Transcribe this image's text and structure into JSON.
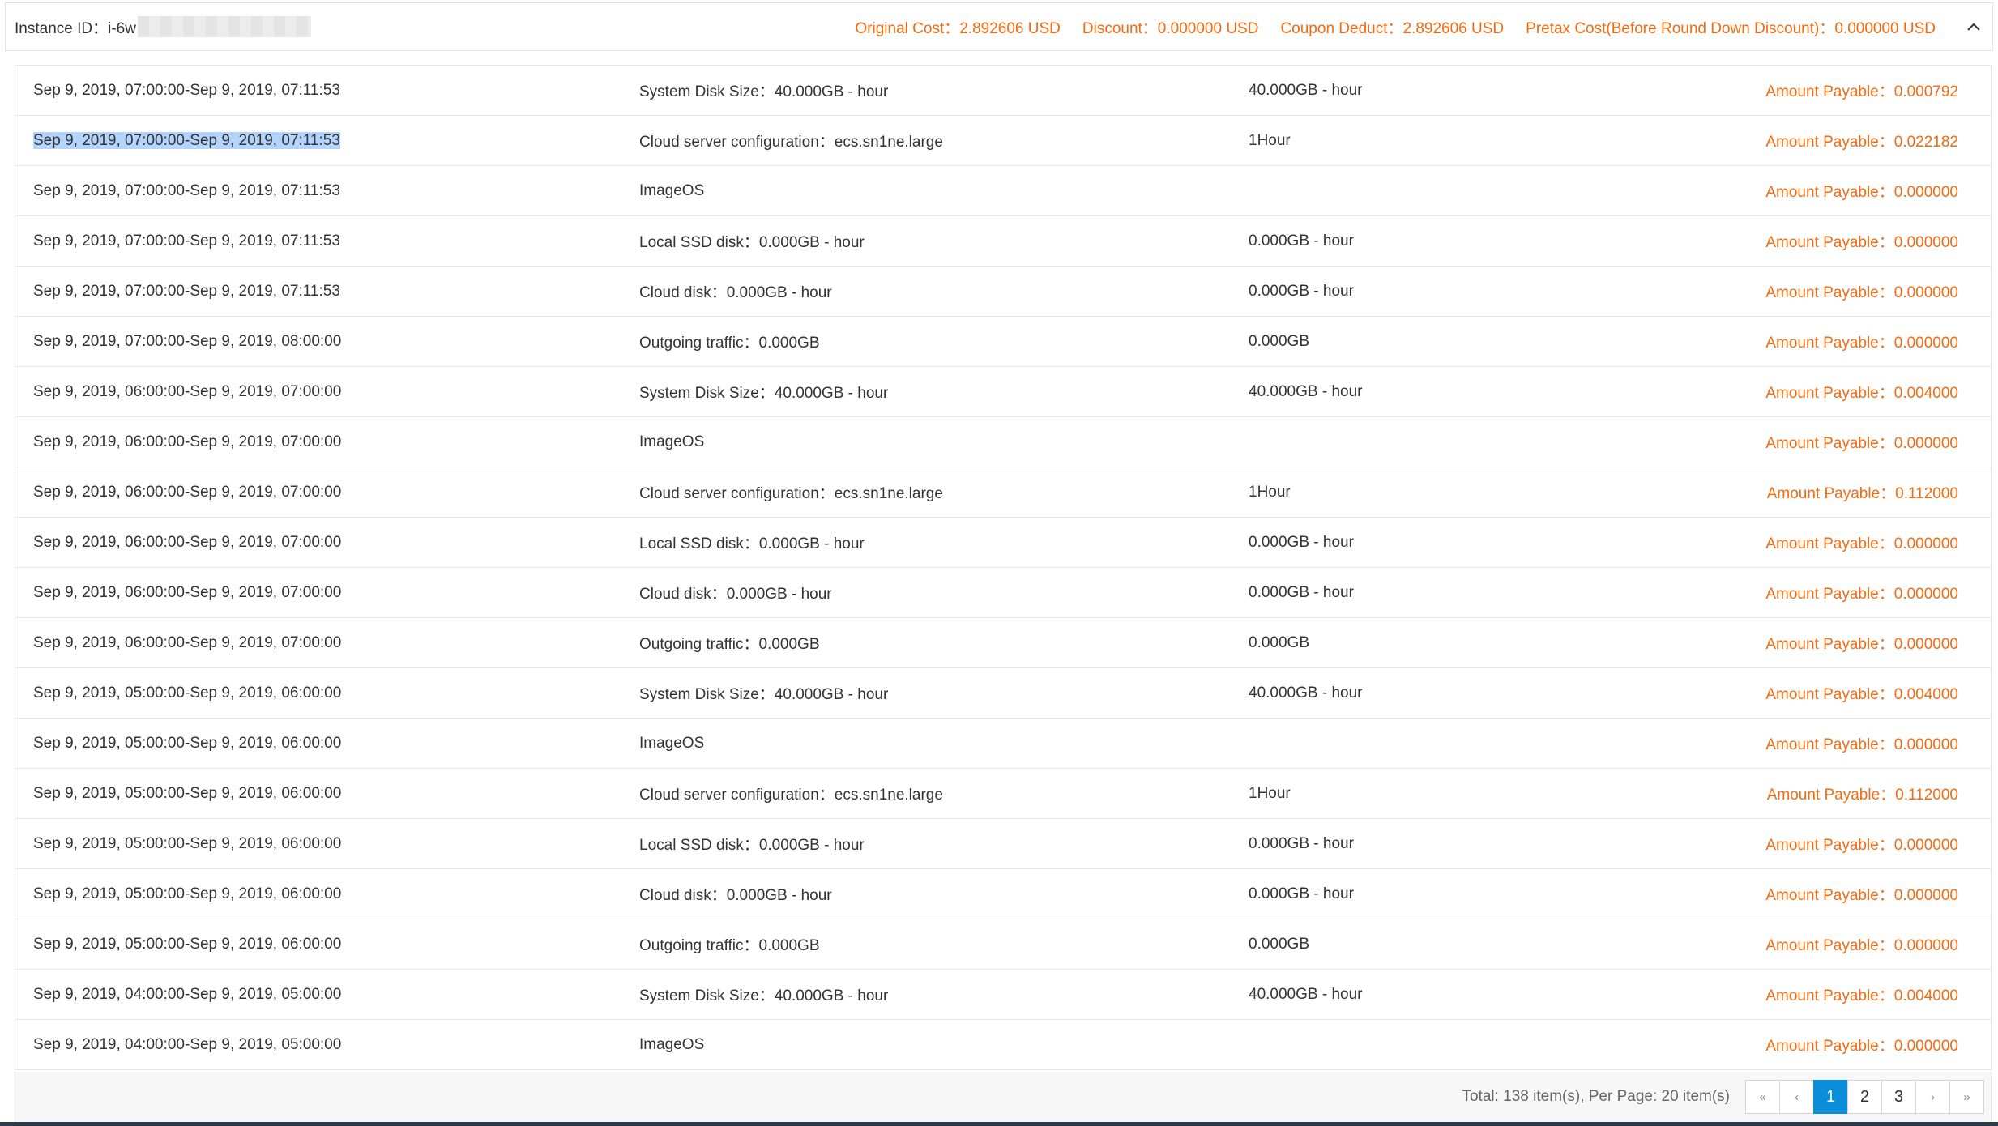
{
  "header": {
    "instance_label": "Instance ID：i-6w",
    "original_cost": "Original Cost：2.892606 USD",
    "discount": "Discount：0.000000 USD",
    "coupon_deduct": "Coupon Deduct：2.892606 USD",
    "pretax_cost": "Pretax Cost(Before Round Down Discount)：0.000000 USD",
    "collapse_icon": "chevron-up-icon"
  },
  "rows": [
    {
      "period": "Sep 9, 2019, 07:00:00-Sep 9, 2019, 07:11:53",
      "item": "System Disk Size：40.000GB - hour",
      "usage": "40.000GB - hour",
      "amount": "Amount Payable：0.000792"
    },
    {
      "period": "Sep 9, 2019, 07:00:00-Sep 9, 2019, 07:11:53",
      "item": "Cloud server configuration：ecs.sn1ne.large",
      "usage": "1Hour",
      "amount": "Amount Payable：0.022182"
    },
    {
      "period": "Sep 9, 2019, 07:00:00-Sep 9, 2019, 07:11:53",
      "item": "ImageOS",
      "usage": "",
      "amount": "Amount Payable：0.000000"
    },
    {
      "period": "Sep 9, 2019, 07:00:00-Sep 9, 2019, 07:11:53",
      "item": "Local SSD disk：0.000GB - hour",
      "usage": "0.000GB - hour",
      "amount": "Amount Payable：0.000000"
    },
    {
      "period": "Sep 9, 2019, 07:00:00-Sep 9, 2019, 07:11:53",
      "item": "Cloud disk：0.000GB - hour",
      "usage": "0.000GB - hour",
      "amount": "Amount Payable：0.000000"
    },
    {
      "period": "Sep 9, 2019, 07:00:00-Sep 9, 2019, 08:00:00",
      "item": "Outgoing traffic：0.000GB",
      "usage": "0.000GB",
      "amount": "Amount Payable：0.000000"
    },
    {
      "period": "Sep 9, 2019, 06:00:00-Sep 9, 2019, 07:00:00",
      "item": "System Disk Size：40.000GB - hour",
      "usage": "40.000GB - hour",
      "amount": "Amount Payable：0.004000"
    },
    {
      "period": "Sep 9, 2019, 06:00:00-Sep 9, 2019, 07:00:00",
      "item": "ImageOS",
      "usage": "",
      "amount": "Amount Payable：0.000000"
    },
    {
      "period": "Sep 9, 2019, 06:00:00-Sep 9, 2019, 07:00:00",
      "item": "Cloud server configuration：ecs.sn1ne.large",
      "usage": "1Hour",
      "amount": "Amount Payable：0.112000"
    },
    {
      "period": "Sep 9, 2019, 06:00:00-Sep 9, 2019, 07:00:00",
      "item": "Local SSD disk：0.000GB - hour",
      "usage": "0.000GB - hour",
      "amount": "Amount Payable：0.000000"
    },
    {
      "period": "Sep 9, 2019, 06:00:00-Sep 9, 2019, 07:00:00",
      "item": "Cloud disk：0.000GB - hour",
      "usage": "0.000GB - hour",
      "amount": "Amount Payable：0.000000"
    },
    {
      "period": "Sep 9, 2019, 06:00:00-Sep 9, 2019, 07:00:00",
      "item": "Outgoing traffic：0.000GB",
      "usage": "0.000GB",
      "amount": "Amount Payable：0.000000"
    },
    {
      "period": "Sep 9, 2019, 05:00:00-Sep 9, 2019, 06:00:00",
      "item": "System Disk Size：40.000GB - hour",
      "usage": "40.000GB - hour",
      "amount": "Amount Payable：0.004000"
    },
    {
      "period": "Sep 9, 2019, 05:00:00-Sep 9, 2019, 06:00:00",
      "item": "ImageOS",
      "usage": "",
      "amount": "Amount Payable：0.000000"
    },
    {
      "period": "Sep 9, 2019, 05:00:00-Sep 9, 2019, 06:00:00",
      "item": "Cloud server configuration：ecs.sn1ne.large",
      "usage": "1Hour",
      "amount": "Amount Payable：0.112000"
    },
    {
      "period": "Sep 9, 2019, 05:00:00-Sep 9, 2019, 06:00:00",
      "item": "Local SSD disk：0.000GB - hour",
      "usage": "0.000GB - hour",
      "amount": "Amount Payable：0.000000"
    },
    {
      "period": "Sep 9, 2019, 05:00:00-Sep 9, 2019, 06:00:00",
      "item": "Cloud disk：0.000GB - hour",
      "usage": "0.000GB - hour",
      "amount": "Amount Payable：0.000000"
    },
    {
      "period": "Sep 9, 2019, 05:00:00-Sep 9, 2019, 06:00:00",
      "item": "Outgoing traffic：0.000GB",
      "usage": "0.000GB",
      "amount": "Amount Payable：0.000000"
    },
    {
      "period": "Sep 9, 2019, 04:00:00-Sep 9, 2019, 05:00:00",
      "item": "System Disk Size：40.000GB - hour",
      "usage": "40.000GB - hour",
      "amount": "Amount Payable：0.004000"
    },
    {
      "period": "Sep 9, 2019, 04:00:00-Sep 9, 2019, 05:00:00",
      "item": "ImageOS",
      "usage": "",
      "amount": "Amount Payable：0.000000"
    }
  ],
  "pagination": {
    "total_text": "Total: 138 item(s), Per Page: 20 item(s)",
    "first": "«",
    "prev": "‹",
    "pages": [
      "1",
      "2",
      "3"
    ],
    "active_page": "1",
    "next": "›",
    "last": "»"
  },
  "colors": {
    "accent_orange": "#f36b10",
    "active_page_blue": "#0a8ed9",
    "selection_highlight": "#b3d4fc"
  }
}
